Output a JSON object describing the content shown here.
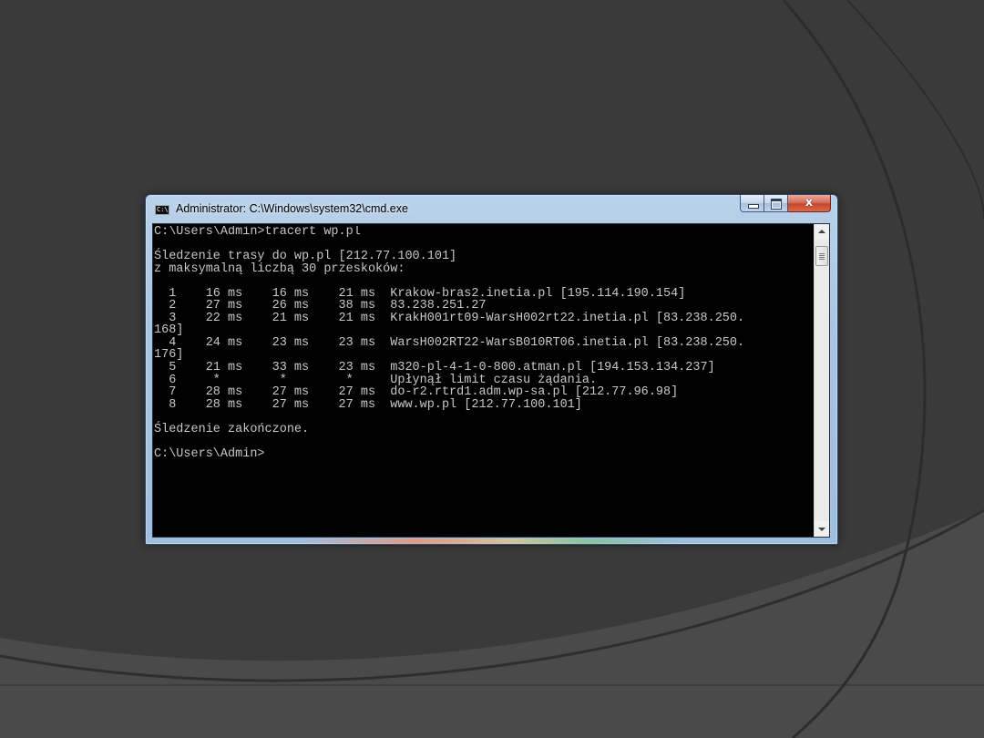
{
  "window": {
    "title": "Administrator: C:\\Windows\\system32\\cmd.exe",
    "icon": "cmd-icon",
    "icon_text": "C:\\",
    "buttons": {
      "minimize": "minimize-icon",
      "maximize": "maximize-icon",
      "close": "x"
    }
  },
  "console": {
    "lines": [
      "C:\\Users\\Admin>tracert wp.pl",
      "",
      "Śledzenie trasy do wp.pl [212.77.100.101]",
      "z maksymalną liczbą 30 przeskoków:",
      "",
      "  1    16 ms    16 ms    21 ms  Krakow-bras2.inetia.pl [195.114.190.154]",
      "  2    27 ms    26 ms    38 ms  83.238.251.27",
      "  3    22 ms    21 ms    21 ms  KrakH001rt09-WarsH002rt22.inetia.pl [83.238.250.",
      "168]",
      "  4    24 ms    23 ms    23 ms  WarsH002RT22-WarsB010RT06.inetia.pl [83.238.250.",
      "176]",
      "  5    21 ms    33 ms    23 ms  m320-pl-4-1-0-800.atman.pl [194.153.134.237]",
      "  6     *        *        *     Upłynął limit czasu żądania.",
      "  7    28 ms    27 ms    27 ms  do-r2.rtrd1.adm.wp-sa.pl [212.77.96.98]",
      "  8    28 ms    27 ms    27 ms  www.wp.pl [212.77.100.101]",
      "",
      "Śledzenie zakończone.",
      "",
      "C:\\Users\\Admin>"
    ]
  },
  "colors": {
    "console_bg": "#000000",
    "console_fg": "#c8c8c8",
    "desktop_bg": "#3a3a3a",
    "title_bar": "#a9c4e2"
  }
}
